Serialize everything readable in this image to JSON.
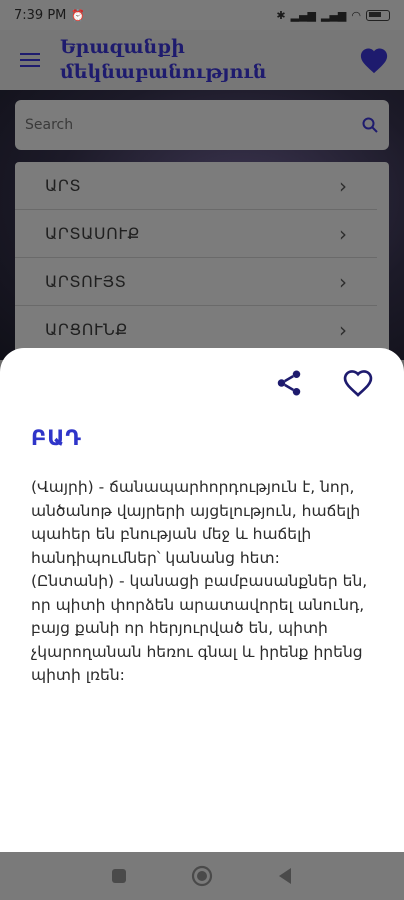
{
  "status": {
    "time": "7:39 PM",
    "battery": "68"
  },
  "app": {
    "title": "Երազանքի մեկնաբանություն"
  },
  "search": {
    "placeholder": "Search"
  },
  "list": {
    "items": [
      {
        "label": "ԱՐՏ"
      },
      {
        "label": "ԱՐՏԱՍՈՒՔ"
      },
      {
        "label": "ԱՐՏՈՒՅՏ"
      },
      {
        "label": "ԱՐՑՈՒՆՔ"
      }
    ]
  },
  "sheet": {
    "title": "ԲԱԴ",
    "paragraph1": "(Վայրի) - ճանապարհորդություն է, նոր, անծանոթ վայրերի այցելություն, հաճելի պահեր են բնության մեջ և հաճելի հանդիպումներ՝ կանանց հետ:",
    "paragraph2": "(Ընտանի) - կանացի բամբասանքներ են, որ պիտի փորձեն արատավորել անունդ, բայց քանի որ հերյուրված են, պիտի չկարողանան հեռու գնալ և իրենք իրենց պիտի լռեն:"
  },
  "colors": {
    "accent": "#2f35c9",
    "title": "#1e1b6e"
  }
}
